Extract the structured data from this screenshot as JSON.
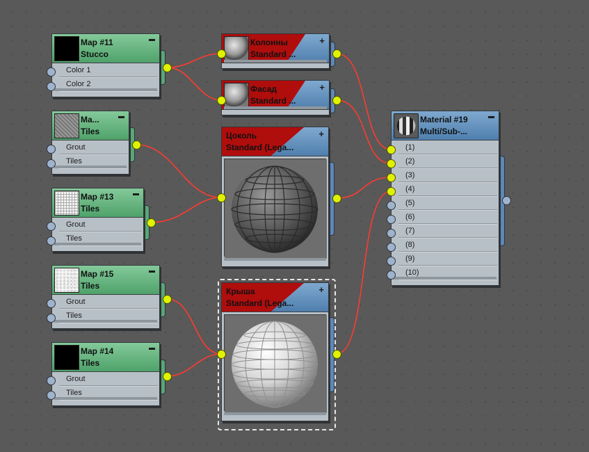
{
  "nodes": {
    "map11": {
      "name": "Map #11",
      "type": "Stucco",
      "rows": [
        "Color 1",
        "Color 2"
      ]
    },
    "map_tiles_a": {
      "name": "Ma...",
      "type": "Tiles",
      "rows": [
        "Grout",
        "Tiles"
      ]
    },
    "map13": {
      "name": "Map #13",
      "type": "Tiles",
      "rows": [
        "Grout",
        "Tiles"
      ]
    },
    "map15": {
      "name": "Map #15",
      "type": "Tiles",
      "rows": [
        "Grout",
        "Tiles"
      ]
    },
    "map14": {
      "name": "Map #14",
      "type": "Tiles",
      "rows": [
        "Grout",
        "Tiles"
      ]
    },
    "kolonny": {
      "name": "Колонны",
      "type": "Standard ..."
    },
    "fasad": {
      "name": "Фасад",
      "type": "Standard ..."
    },
    "cokol": {
      "name": "Цоколь",
      "type": "Standard  (Lega..."
    },
    "krysha": {
      "name": "Крыша",
      "type": "Standard  (Lega..."
    },
    "material19": {
      "name": "Material #19",
      "type": "Multi/Sub-...",
      "slots": [
        "(1)",
        "(2)",
        "(3)",
        "(4)",
        "(5)",
        "(6)",
        "(7)",
        "(8)",
        "(9)",
        "(10)"
      ]
    }
  },
  "icons": {
    "minimize": "minus-icon",
    "add": "plus-icon"
  },
  "colors": {
    "wire": "#ff3b2f",
    "socket_connected": "#e0f200",
    "socket_empty": "#9fb3cc",
    "map_header": "#5fae7a",
    "material_header": "#5d8cbb",
    "selected_header": "#b00d0d"
  }
}
